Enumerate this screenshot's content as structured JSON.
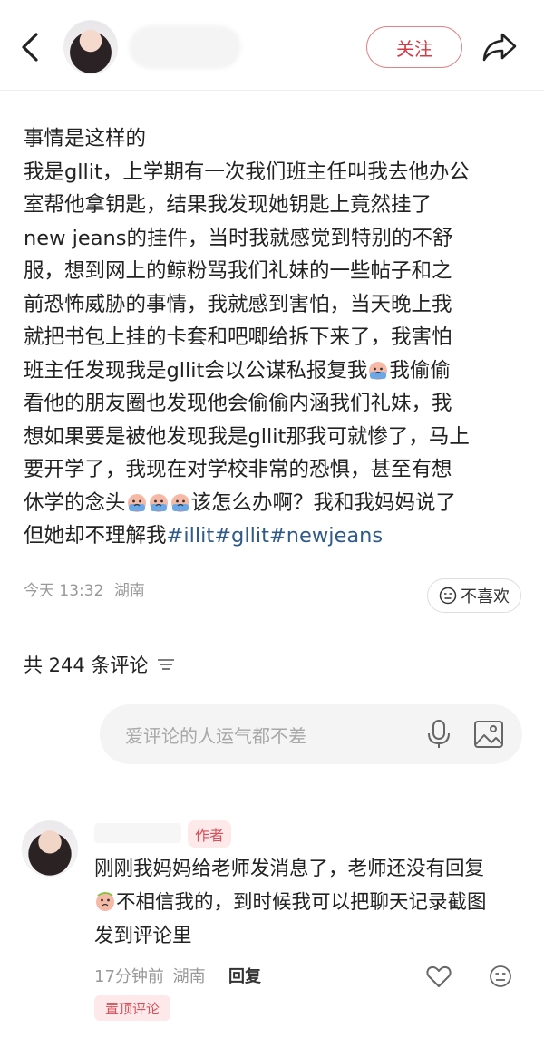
{
  "header": {
    "follow_label": "关注"
  },
  "post": {
    "lines": [
      "事情是这样的",
      "我是gllit，上学期有一次我们班主任叫我去他办公",
      "室帮他拿钥匙，结果我发现她钥匙上竟然挂了",
      "new jeans的挂件，当时我就感觉到特别的不舒",
      "服，想到网上的鲸粉骂我们礼妹的一些帖子和之",
      "前恐怖威胁的事情，我就感到害怕，当天晚上我",
      "就把书包上挂的卡套和吧唧给拆下来了，我害怕"
    ],
    "line8_a": "班主任发现我是gllit会以公谋私报复我",
    "line8_b": "我偷偷",
    "line9": "看他的朋友圈也发现他会偷偷内涵我们礼妹，我",
    "line10": "想如果要是被他发现我是gllit那我可就惨了，马上",
    "line11": "要开学了，我现在对学校非常的恐惧，甚至有想",
    "line12_a": "休学的念头",
    "line12_b": "该怎么办啊？我和我妈妈说了",
    "line13_a": "但她却不理解我",
    "tags": [
      "#illit",
      "#gllit",
      "#newjeans"
    ],
    "time": "今天 13:32",
    "location": "湖南",
    "dislike_label": "不喜欢"
  },
  "comments_section": {
    "count_label": "共 244 条评论",
    "input_placeholder": "爱评论的人运气都不差"
  },
  "comment": {
    "author_badge": "作者",
    "line1": "刚刚我妈妈给老师发消息了，老师还没有回复",
    "line2": "不相信我的，到时候我可以把聊天记录截图",
    "line3": "发到评论里",
    "time": "17分钟前",
    "location": "湖南",
    "reply_label": "回复",
    "pinned_label": "置顶评论"
  },
  "icons": {
    "back": "chevron-left-icon",
    "share": "share-arrow-icon",
    "sort": "sort-lines-icon",
    "mic": "microphone-icon",
    "image": "image-icon",
    "heart": "heart-icon",
    "dislike": "sad-face-icon",
    "emoji": "crying-emoji-icon"
  },
  "colors": {
    "accent": "#d83a45",
    "tag": "#2f5a8a",
    "muted": "#999999",
    "badge_bg": "#fde8ea"
  }
}
